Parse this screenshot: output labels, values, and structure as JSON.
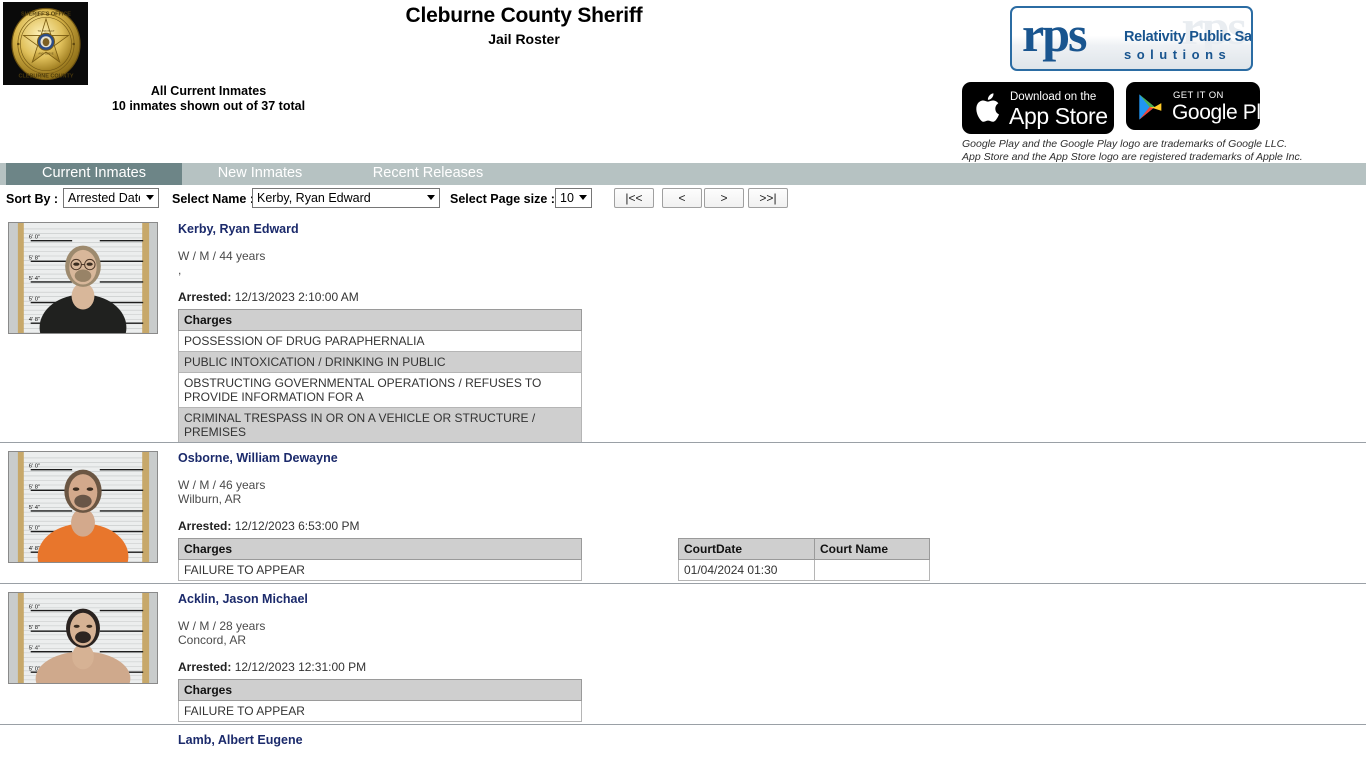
{
  "header": {
    "agency_title": "Cleburne County Sheriff",
    "page_subtitle": "Jail Roster",
    "roster_scope": "All Current Inmates",
    "roster_count": "10 inmates shown out of 37 total",
    "badge_icon": "sheriff-star-badge-icon",
    "badge_text_top": "SHERIFF'S OFFICE",
    "badge_text_bottom": "CLEBURNE COUNTY"
  },
  "branding": {
    "rps_mark": "rps",
    "rps_ghost": "rps",
    "rps_line1": "Relativity Public Safety",
    "rps_line2": "solutions",
    "apple_badge": {
      "icon": "apple-logo-icon",
      "small_text": "Download on the",
      "large_text": "App Store"
    },
    "google_badge": {
      "icon": "google-play-triangle-icon",
      "small_text": "GET IT ON",
      "large_text": "Google Play"
    },
    "trademark_line1": "Google Play and the Google Play logo are trademarks of Google LLC.",
    "trademark_line2": "App Store and the App Store logo are registered trademarks of Apple Inc."
  },
  "tabs": [
    {
      "label": "Current Inmates",
      "active": true
    },
    {
      "label": "New Inmates",
      "active": false
    },
    {
      "label": "Recent Releases",
      "active": false
    }
  ],
  "toolbar": {
    "sort_by_label": "Sort By :",
    "sort_by_value": "Arrested Date",
    "select_name_label": "Select Name :",
    "select_name_value": "Kerby, Ryan Edward",
    "page_size_label": "Select Page size :",
    "page_size_value": "10",
    "nav_first": "|<<",
    "nav_prev": "<",
    "nav_next": ">",
    "nav_last": ">>|"
  },
  "table_headers": {
    "charges": "Charges",
    "court_date": "CourtDate",
    "court_name": "Court Name"
  },
  "labels": {
    "arrested": "Arrested:"
  },
  "inmates": [
    {
      "name": "Kerby, Ryan Edward",
      "demographics": "W / M / 44 years",
      "city": ",",
      "arrested": "12/13/2023 2:10:00 AM",
      "charges": [
        "POSSESSION OF DRUG PARAPHERNALIA",
        "PUBLIC INTOXICATION / DRINKING IN PUBLIC",
        "OBSTRUCTING GOVERNMENTAL OPERATIONS / REFUSES TO PROVIDE INFORMATION FOR A",
        "CRIMINAL TRESPASS IN OR ON A VEHICLE OR STRUCTURE / PREMISES"
      ],
      "court": []
    },
    {
      "name": "Osborne, William Dewayne",
      "demographics": "W / M / 46 years",
      "city": "Wilburn, AR",
      "arrested": "12/12/2023 6:53:00 PM",
      "charges": [
        "FAILURE TO APPEAR"
      ],
      "court": [
        {
          "date": "01/04/2024 01:30",
          "name": ""
        }
      ]
    },
    {
      "name": "Acklin, Jason Michael",
      "demographics": "W / M / 28 years",
      "city": "Concord, AR",
      "arrested": "12/12/2023 12:31:00 PM",
      "charges": [
        "FAILURE TO APPEAR"
      ],
      "court": []
    },
    {
      "name": "Lamb, Albert Eugene",
      "demographics": "",
      "city": "",
      "arrested": "",
      "charges": [],
      "court": []
    }
  ],
  "mugshot_height_marks": [
    "6' 0\"",
    "5' 8\"",
    "5' 4\"",
    "5' 0\"",
    "4' 8\""
  ],
  "colors": {
    "tab_active_bg": "#6d8587",
    "tab_bar_bg": "#b6c2c2",
    "name_link": "#1b2a6b",
    "table_header_bg": "#cfcfcf",
    "table_alt_row_bg": "#cfcfcf",
    "rps_blue": "#19558f",
    "badge_gold": "#d4af37"
  }
}
